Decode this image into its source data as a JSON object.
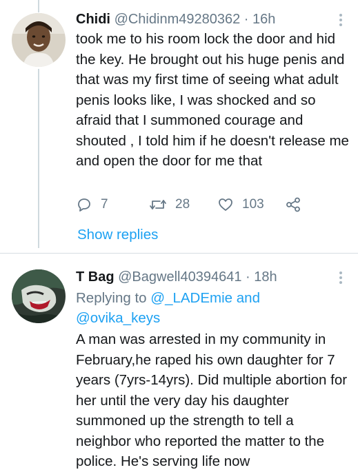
{
  "tweets": [
    {
      "name": "Chidi",
      "handle": "@Chidinm49280362",
      "separator": "·",
      "time": "16h",
      "text": "took me to his room lock the door and hid the key. He brought out his huge penis and that was my first time of seeing what adult penis looks like, I was shocked and so afraid that I summoned courage and shouted , I told him if he doesn't release me and open the door for me that",
      "actions": {
        "reply_count": "7",
        "retweet_count": "28",
        "like_count": "103"
      },
      "show_replies": "Show replies"
    },
    {
      "name": "T Bag",
      "handle": "@Bagwell40394641",
      "separator": "·",
      "time": "18h",
      "replying_prefix": "Replying to",
      "replying_user1": "@_LADEmie",
      "replying_and": "and",
      "replying_user2": "@ovika_keys",
      "text": "A man was arrested in my community in February,he raped his own daughter for 7 years (7yrs-14yrs). Did multiple abortion for her until the very day his daughter summoned up the strength to tell a neighbor who reported the matter to the police. He's serving life now"
    }
  ],
  "colors": {
    "link": "#1da1f2",
    "secondary_text": "#657786",
    "primary_text": "#14171a",
    "divider": "#d6dde2"
  },
  "icons": {
    "reply": "reply-icon",
    "retweet": "retweet-icon",
    "like": "heart-icon",
    "share": "share-icon",
    "more": "more-vertical-icon"
  }
}
